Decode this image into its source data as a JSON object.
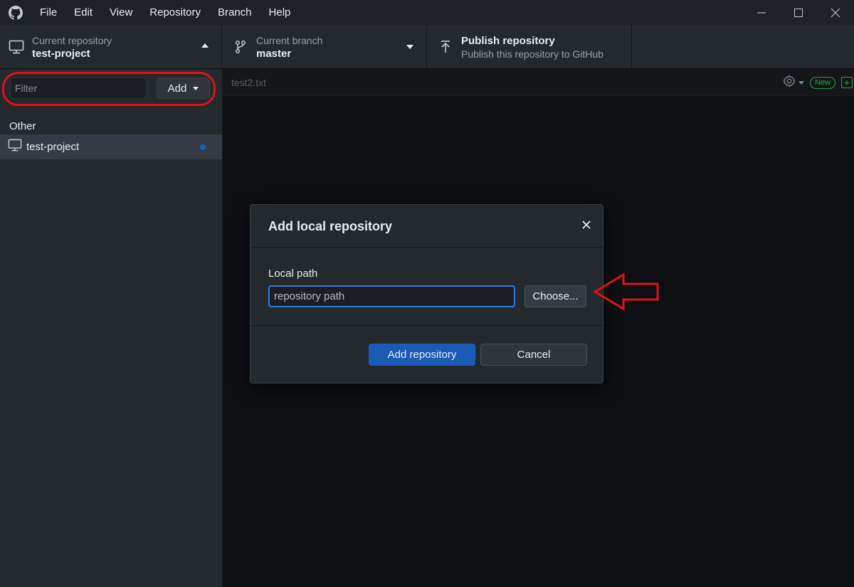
{
  "menu": {
    "items": [
      "File",
      "Edit",
      "View",
      "Repository",
      "Branch",
      "Help"
    ]
  },
  "window_controls": {
    "minimize": "—",
    "maximize": "☐",
    "close": "✕"
  },
  "toolbar": {
    "repository": {
      "label": "Current repository",
      "value": "test-project"
    },
    "branch": {
      "label": "Current branch",
      "value": "master"
    },
    "publish": {
      "title": "Publish repository",
      "subtitle": "Publish this repository to GitHub"
    }
  },
  "sidebar": {
    "filter_placeholder": "Filter",
    "add_label": "Add",
    "group_label": "Other",
    "repos": [
      {
        "name": "test-project"
      }
    ]
  },
  "main": {
    "file_name": "test2.txt",
    "new_badge": "New"
  },
  "modal": {
    "title": "Add local repository",
    "field_label": "Local path",
    "path_placeholder": "repository path",
    "choose_label": "Choose...",
    "primary_label": "Add repository",
    "cancel_label": "Cancel"
  },
  "colors": {
    "annotation_red": "#e0101c",
    "accent_blue": "#1a5bb5",
    "focus_blue": "#2f7fe0",
    "success_green": "#2ea043"
  },
  "icons": {
    "app": "github-logo-icon",
    "repository": "desktop-computer-icon",
    "branch": "git-branch-icon",
    "publish": "upload-arrow-icon",
    "settings": "gear-icon",
    "close": "close-icon",
    "annotation": "red-arrow-icon"
  }
}
